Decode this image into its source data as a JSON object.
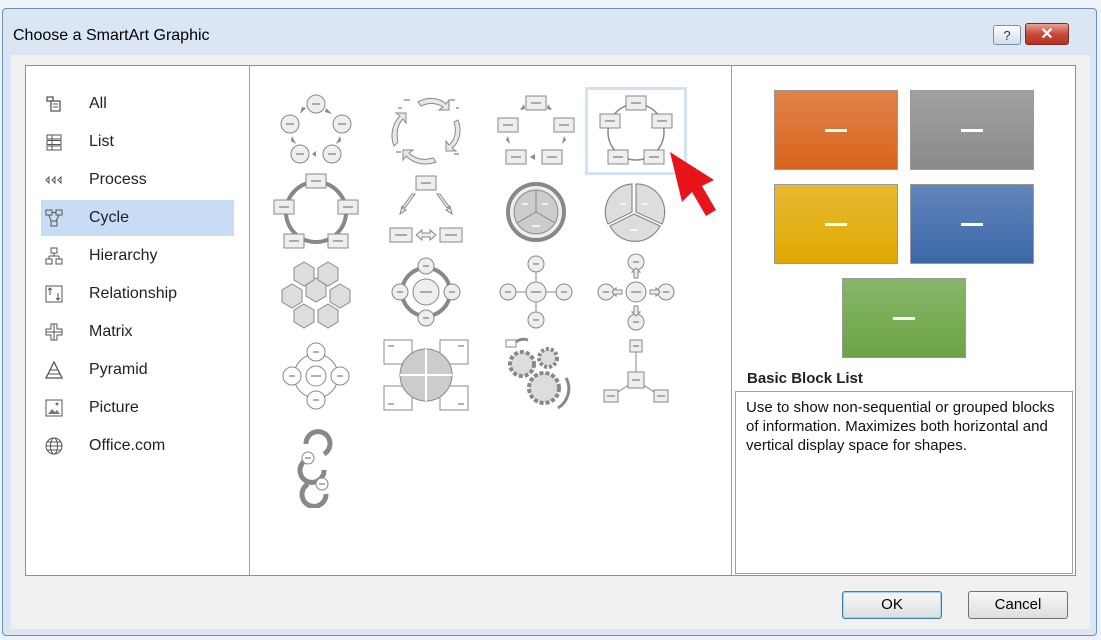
{
  "dialog": {
    "title": "Choose a SmartArt Graphic",
    "help_label": "?",
    "close_label": "✕"
  },
  "categories": [
    {
      "label": "All",
      "icon": "all-icon"
    },
    {
      "label": "List",
      "icon": "list-icon"
    },
    {
      "label": "Process",
      "icon": "process-icon"
    },
    {
      "label": "Cycle",
      "icon": "cycle-icon",
      "selected": true
    },
    {
      "label": "Hierarchy",
      "icon": "hierarchy-icon"
    },
    {
      "label": "Relationship",
      "icon": "relationship-icon"
    },
    {
      "label": "Matrix",
      "icon": "matrix-icon"
    },
    {
      "label": "Pyramid",
      "icon": "pyramid-icon"
    },
    {
      "label": "Picture",
      "icon": "picture-icon"
    },
    {
      "label": "Office.com",
      "icon": "globe-icon"
    }
  ],
  "gallery": {
    "selected_index": 3,
    "item_count": 17
  },
  "preview": {
    "colors": [
      "#d9641d",
      "#8a8a8a",
      "#e0a800",
      "#3c67a8",
      "#6aa444"
    ],
    "placeholder": "—",
    "title": "Basic Block List",
    "description": "Use to show non-sequential or grouped blocks of information. Maximizes both horizontal and vertical display space for shapes."
  },
  "buttons": {
    "ok": "OK",
    "cancel": "Cancel"
  },
  "annotation": {
    "pointer_color": "#e8141b"
  }
}
